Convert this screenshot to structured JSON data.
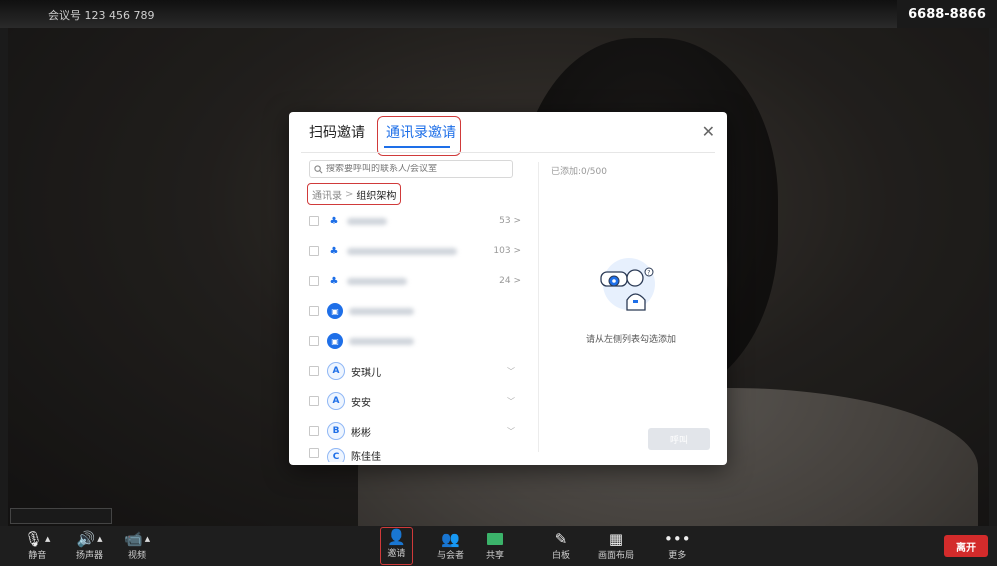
{
  "topbar": {
    "meeting_id": "会议号 123 456 789",
    "right_number": "6688-8866"
  },
  "dialog": {
    "tabs": [
      {
        "label": "扫码邀请",
        "active": false
      },
      {
        "label": "通讯录邀请",
        "active": true
      }
    ],
    "close_icon": "close-icon",
    "search": {
      "placeholder": "搜索要呼叫的联系人/会议室",
      "value": ""
    },
    "breadcrumb": {
      "root": "通讯录",
      "separator": ">",
      "current": "组织架构"
    },
    "list": [
      {
        "type": "department",
        "name": "",
        "count": "53 >"
      },
      {
        "type": "department",
        "name": "",
        "count": "103 >"
      },
      {
        "type": "department",
        "name": "",
        "count": "24 >"
      },
      {
        "type": "room",
        "name": ""
      },
      {
        "type": "room",
        "name": ""
      },
      {
        "type": "contact",
        "initial": "A",
        "name": "安琪儿"
      },
      {
        "type": "contact",
        "initial": "A",
        "name": "安安"
      },
      {
        "type": "contact",
        "initial": "B",
        "name": "彬彬"
      },
      {
        "type": "contact",
        "initial": "C",
        "name": "陈佳佳"
      }
    ],
    "added_label": "已添加:0/500",
    "empty_hint": "请从左侧列表勾选添加",
    "call_button": "呼叫"
  },
  "toolbar": {
    "left": [
      {
        "label": "静音",
        "icon": "microphone-icon"
      },
      {
        "label": "扬声器",
        "icon": "speaker-icon"
      },
      {
        "label": "视频",
        "icon": "camera-icon"
      }
    ],
    "center": [
      {
        "label": "邀请",
        "icon": "invite-icon"
      },
      {
        "label": "与会者",
        "icon": "participants-icon"
      },
      {
        "label": "共享",
        "icon": "share-icon"
      },
      {
        "label": "白板",
        "icon": "whiteboard-icon"
      },
      {
        "label": "画面布局",
        "icon": "layout-icon"
      },
      {
        "label": "更多",
        "icon": "more-icon"
      }
    ],
    "leave_label": "离开",
    "colors": {
      "leave": "#d32b2b",
      "accent": "#1e6fe8",
      "highlight": "#d03a3a",
      "share": "#3bb36a"
    }
  }
}
